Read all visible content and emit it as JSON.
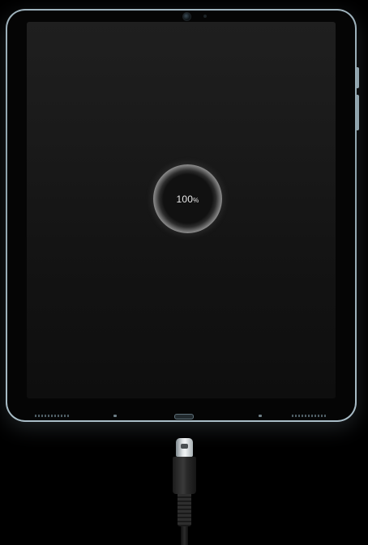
{
  "device": {
    "type": "tablet",
    "state": "charging"
  },
  "charge_indicator": {
    "value": "100",
    "unit": "%",
    "level_percent": 100
  },
  "cable": {
    "connector": "usb-c",
    "color": "#1e1e1e"
  },
  "colors": {
    "background": "#000000",
    "frame": "#9fb3bd",
    "screen": "#1a1a1a",
    "indicator_text": "#e8e8e8"
  }
}
